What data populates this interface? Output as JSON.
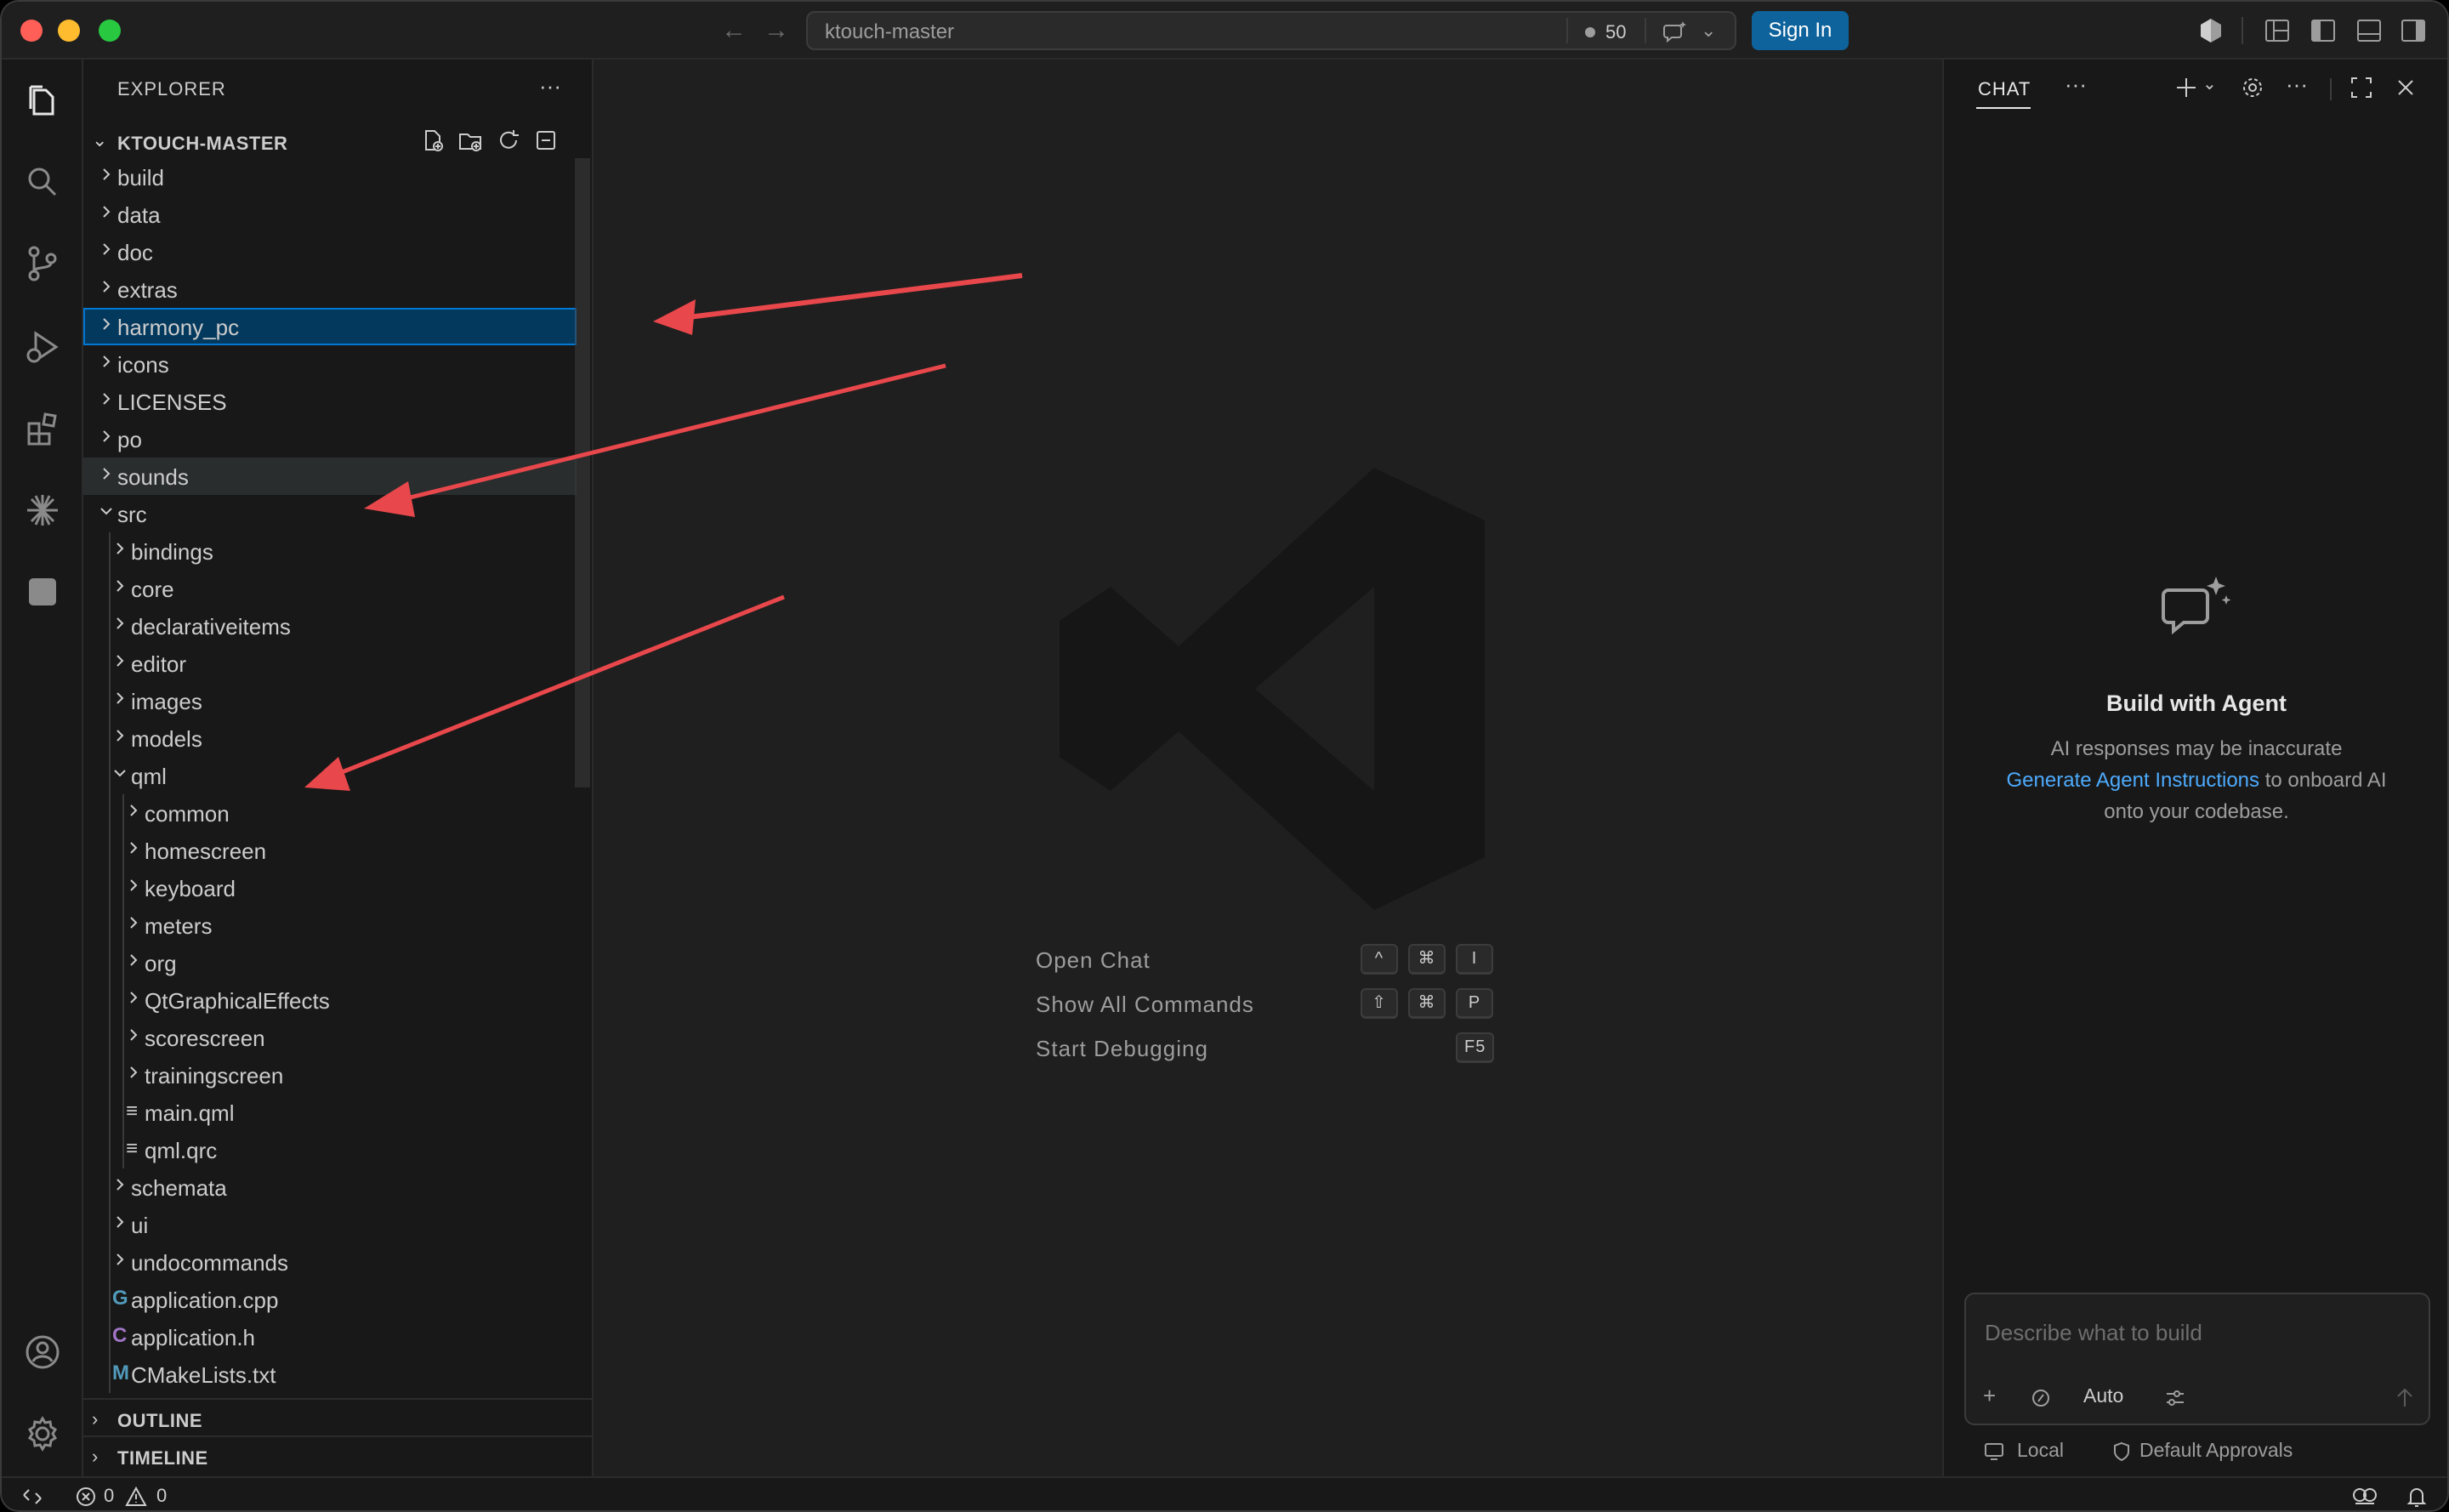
{
  "titlebar": {
    "search_title": "ktouch-master",
    "count": "50",
    "sign_in": "Sign In"
  },
  "sidebar": {
    "title": "EXPLORER",
    "project": "KTOUCH-MASTER",
    "tree": [
      {
        "label": "build",
        "type": "folder",
        "depth": 0,
        "expanded": false
      },
      {
        "label": "data",
        "type": "folder",
        "depth": 0,
        "expanded": false
      },
      {
        "label": "doc",
        "type": "folder",
        "depth": 0,
        "expanded": false
      },
      {
        "label": "extras",
        "type": "folder",
        "depth": 0,
        "expanded": false
      },
      {
        "label": "harmony_pc",
        "type": "folder",
        "depth": 0,
        "expanded": false,
        "selected": true
      },
      {
        "label": "icons",
        "type": "folder",
        "depth": 0,
        "expanded": false
      },
      {
        "label": "LICENSES",
        "type": "folder",
        "depth": 0,
        "expanded": false
      },
      {
        "label": "po",
        "type": "folder",
        "depth": 0,
        "expanded": false
      },
      {
        "label": "sounds",
        "type": "folder",
        "depth": 0,
        "expanded": false,
        "hover": true
      },
      {
        "label": "src",
        "type": "folder",
        "depth": 0,
        "expanded": true
      },
      {
        "label": "bindings",
        "type": "folder",
        "depth": 1,
        "expanded": false
      },
      {
        "label": "core",
        "type": "folder",
        "depth": 1,
        "expanded": false
      },
      {
        "label": "declarativeitems",
        "type": "folder",
        "depth": 1,
        "expanded": false
      },
      {
        "label": "editor",
        "type": "folder",
        "depth": 1,
        "expanded": false
      },
      {
        "label": "images",
        "type": "folder",
        "depth": 1,
        "expanded": false
      },
      {
        "label": "models",
        "type": "folder",
        "depth": 1,
        "expanded": false
      },
      {
        "label": "qml",
        "type": "folder",
        "depth": 1,
        "expanded": true
      },
      {
        "label": "common",
        "type": "folder",
        "depth": 2,
        "expanded": false
      },
      {
        "label": "homescreen",
        "type": "folder",
        "depth": 2,
        "expanded": false
      },
      {
        "label": "keyboard",
        "type": "folder",
        "depth": 2,
        "expanded": false
      },
      {
        "label": "meters",
        "type": "folder",
        "depth": 2,
        "expanded": false
      },
      {
        "label": "org",
        "type": "folder",
        "depth": 2,
        "expanded": false
      },
      {
        "label": "QtGraphicalEffects",
        "type": "folder",
        "depth": 2,
        "expanded": false
      },
      {
        "label": "scorescreen",
        "type": "folder",
        "depth": 2,
        "expanded": false
      },
      {
        "label": "trainingscreen",
        "type": "folder",
        "depth": 2,
        "expanded": false
      },
      {
        "label": "main.qml",
        "type": "file",
        "depth": 2,
        "icon": "lines"
      },
      {
        "label": "qml.qrc",
        "type": "file",
        "depth": 2,
        "icon": "lines"
      },
      {
        "label": "schemata",
        "type": "folder",
        "depth": 1,
        "expanded": false
      },
      {
        "label": "ui",
        "type": "folder",
        "depth": 1,
        "expanded": false
      },
      {
        "label": "undocommands",
        "type": "folder",
        "depth": 1,
        "expanded": false
      },
      {
        "label": "application.cpp",
        "type": "file",
        "depth": 1,
        "icon": "cpp"
      },
      {
        "label": "application.h",
        "type": "file",
        "depth": 1,
        "icon": "h"
      },
      {
        "label": "CMakeLists.txt",
        "type": "file",
        "depth": 1,
        "icon": "cmake"
      }
    ],
    "outline": "OUTLINE",
    "timeline": "TIMELINE"
  },
  "file_icons": {
    "cpp": {
      "glyph": "G",
      "color": "#519aba"
    },
    "h": {
      "glyph": "C",
      "color": "#a074c4"
    },
    "cmake": {
      "glyph": "M",
      "color": "#519aba"
    },
    "lines": {
      "glyph": "≡",
      "color": "#cccccc"
    }
  },
  "editor": {
    "shortcuts": [
      {
        "label": "Open Chat",
        "keys": [
          "^",
          "⌘",
          "I"
        ]
      },
      {
        "label": "Show All Commands",
        "keys": [
          "⇧",
          "⌘",
          "P"
        ]
      },
      {
        "label": "Start Debugging",
        "keys": [
          "F5"
        ]
      }
    ]
  },
  "chat": {
    "tab": "CHAT",
    "title": "Build with Agent",
    "subtitle": "AI responses may be inaccurate",
    "link": "Generate Agent Instructions",
    "after_link": " to onboard AI",
    "line3": "onto your codebase.",
    "input_placeholder": "Describe what to build",
    "mode": "Auto",
    "local": "Local",
    "approvals": "Default Approvals"
  },
  "statusbar": {
    "errors": "0",
    "warnings": "0"
  },
  "colors": {
    "accent": "#0078d4",
    "signin": "#0e639c",
    "arrow": "#e8474b",
    "link": "#4daafc"
  }
}
